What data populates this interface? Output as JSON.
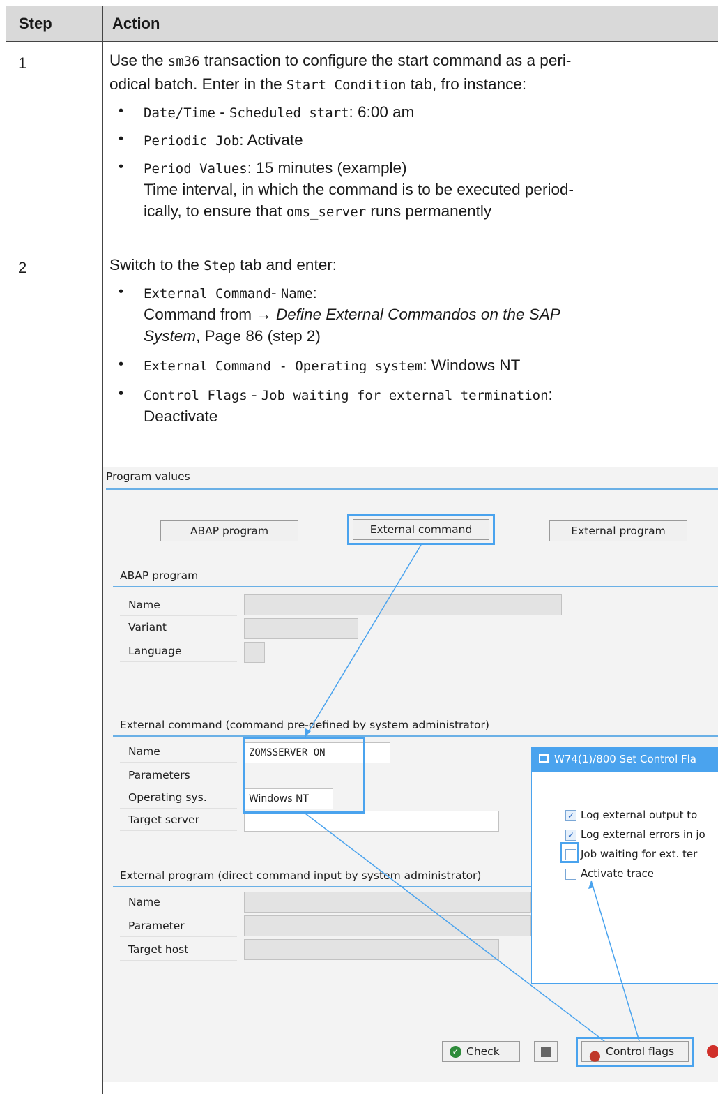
{
  "table": {
    "headers": {
      "step": "Step",
      "action": "Action"
    },
    "rows": [
      {
        "step": "1",
        "intro": [
          [
            {
              "t": "Use the "
            },
            {
              "t": "sm36",
              "mono": true
            },
            {
              "t": " transaction to configure the start command as a peri-"
            }
          ],
          [
            {
              "t": "odical batch. Enter in the "
            },
            {
              "t": "Start Condition",
              "mono": true
            },
            {
              "t": " tab, fro instance:"
            }
          ]
        ],
        "bullets": [
          [
            [
              {
                "t": "Date/Time",
                "mono": true
              },
              {
                "t": " - "
              },
              {
                "t": "Scheduled start",
                "mono": true
              },
              {
                "t": ": 6:00 am"
              }
            ]
          ],
          [
            [
              {
                "t": "Periodic Job",
                "mono": true
              },
              {
                "t": ": Activate"
              }
            ]
          ],
          [
            [
              {
                "t": "Period Values",
                "mono": true
              },
              {
                "t": ": 15 minutes (example)"
              }
            ],
            [
              {
                "t": "Time interval, in which the command is to be executed period-"
              }
            ],
            [
              {
                "t": "ically, to ensure that "
              },
              {
                "t": "oms_server",
                "mono": true
              },
              {
                "t": " runs permanently"
              }
            ]
          ]
        ]
      },
      {
        "step": "2",
        "intro": [
          [
            {
              "t": "Switch to the "
            },
            {
              "t": "Step",
              "mono": true
            },
            {
              "t": " tab and enter:"
            }
          ]
        ],
        "bullets": [
          [
            [
              {
                "t": "External Command",
                "mono": true
              },
              {
                "t": "- "
              },
              {
                "t": "Name",
                "mono": true
              },
              {
                "t": ":"
              }
            ],
            [
              {
                "t": "Command from → "
              },
              {
                "t": "Define External Commandos on the SAP",
                "italic": true
              }
            ],
            [
              {
                "t": "System",
                "italic": true
              },
              {
                "t": ", Page 86 (step 2)"
              }
            ]
          ],
          [
            [
              {
                "t": "External Command - Operating system",
                "mono": true
              },
              {
                "t": ": Windows NT"
              }
            ]
          ],
          [
            [
              {
                "t": "Control Flags",
                "mono": true
              },
              {
                "t": " - "
              },
              {
                "t": "Job waiting for external termination",
                "mono": true
              },
              {
                "t": ":"
              }
            ],
            [
              {
                "t": "Deactivate"
              }
            ]
          ]
        ]
      }
    ]
  },
  "screenshot": {
    "program_values_title": "Program values",
    "btn_abap": "ABAP program",
    "btn_external_command": "External command",
    "btn_external_program": "External program",
    "abap_section_title": "ABAP program",
    "abap_labels": [
      "Name",
      "Variant",
      "Language"
    ],
    "ext_cmd_section_title": "External command (command pre-defined by system administrator)",
    "ext_cmd_labels": [
      "Name",
      "Parameters",
      "Operating sys.",
      "Target server"
    ],
    "ext_cmd_name_value": "ZOMSSERVER_ON",
    "ext_cmd_os_value": "Windows NT",
    "ext_prog_section_title": "External program (direct command input by system administrator)",
    "ext_prog_labels": [
      "Name",
      "Parameter",
      "Target host"
    ],
    "dialog_title": "W74(1)/800 Set Control Fla",
    "dialog_options": [
      {
        "label": "Log external output to",
        "checked": true
      },
      {
        "label": "Log external errors in jo",
        "checked": true
      },
      {
        "label": "Job waiting for ext. ter",
        "checked": false
      },
      {
        "label": "Activate trace",
        "checked": false
      }
    ],
    "btn_check": "Check",
    "btn_control_flags": "Control flags"
  }
}
